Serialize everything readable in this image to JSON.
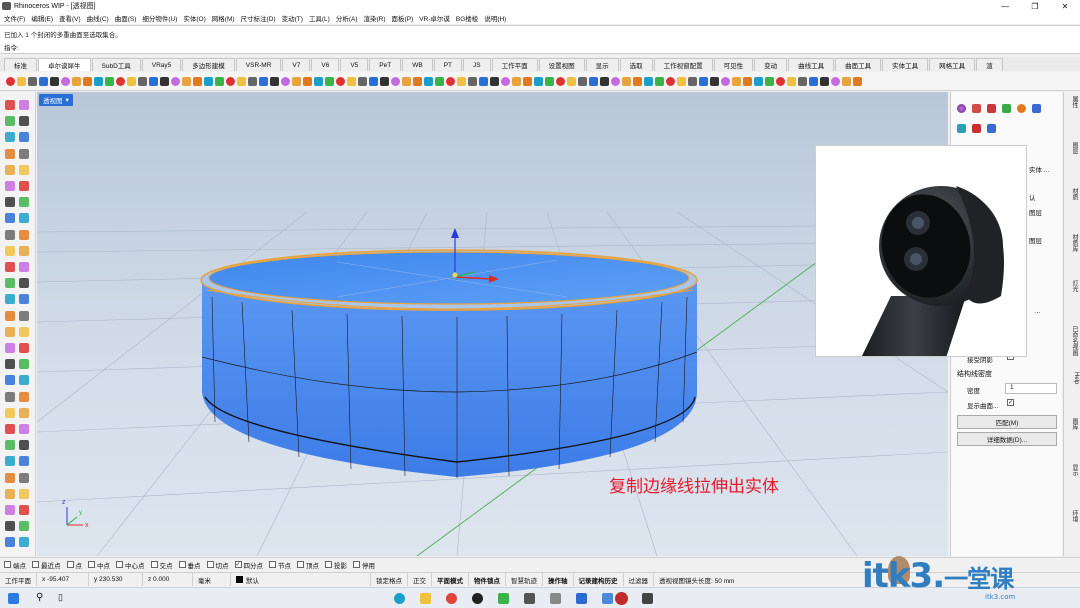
{
  "window": {
    "title": "Rhinoceros WIP - [透视图]",
    "controls": [
      "—",
      "❐",
      "✕"
    ]
  },
  "menu": [
    "文件(F)",
    "编辑(E)",
    "查看(V)",
    "曲线(C)",
    "曲面(S)",
    "细分物件(U)",
    "实体(O)",
    "网格(M)",
    "尺寸标注(D)",
    "变动(T)",
    "工具(L)",
    "分析(A)",
    "渲染(R)",
    "面板(P)",
    "VR-卓尔谟",
    "BG楼梭",
    "说明(H)"
  ],
  "command": {
    "history": "已加入 1 个封闭的多重曲面至选取集合。",
    "prompt": "指令:",
    "input": ""
  },
  "tabs": [
    "标准",
    "卓尔谟犀牛",
    "SubD工具",
    "VRay5",
    "多边形建模",
    "VSR-MR",
    "V7",
    "V6",
    "V5",
    "PeT",
    "WB",
    "PT",
    "JS",
    "工作平面",
    "设置视图",
    "显示",
    "选取",
    "工作视窗配置",
    "可见性",
    "变动",
    "曲线工具",
    "曲面工具",
    "实体工具",
    "网格工具",
    "渲"
  ],
  "active_tab": "卓尔谟犀牛",
  "viewport": {
    "name": "透视图",
    "annotation": "复制边缘线拉伸出实体",
    "axes": {
      "x": "x",
      "y": "y",
      "z": "z"
    }
  },
  "right_panel": {
    "truncated": [
      "实体 ...",
      "认",
      "图层",
      "图层",
      "..."
    ],
    "section_title": "结构线密度",
    "isocurve_label": "接受阴影",
    "density_label": "密度",
    "density_value": "1",
    "show_surface_label": "显示曲面...",
    "match_button": "匹配(M)",
    "details_button": "详细数据(D)..."
  },
  "side_tabs": [
    "属性",
    "图层",
    "材质",
    "材质库",
    "灯光",
    "已命名视图",
    "Help",
    "图库",
    "显示",
    "环境"
  ],
  "osnap": [
    {
      "label": "端点",
      "checked": false
    },
    {
      "label": "最近点",
      "checked": false
    },
    {
      "label": "点",
      "checked": false
    },
    {
      "label": "中点",
      "checked": false
    },
    {
      "label": "中心点",
      "checked": false
    },
    {
      "label": "交点",
      "checked": false
    },
    {
      "label": "垂点",
      "checked": false
    },
    {
      "label": "切点",
      "checked": false
    },
    {
      "label": "四分点",
      "checked": true
    },
    {
      "label": "节点",
      "checked": false
    },
    {
      "label": "顶点",
      "checked": false
    },
    {
      "label": "投影",
      "checked": false
    },
    {
      "label": "停用",
      "checked": false
    }
  ],
  "status": {
    "cplane": "工作平面",
    "x": "x -95.407",
    "y": "y 230.530",
    "z": "z 0.000",
    "unit": "毫米",
    "layer": "默认",
    "toggles": [
      "锁定格点",
      "正交",
      "平面模式",
      "物件锁点",
      "智慧轨迹",
      "操作轴",
      "记录建构历史",
      "过滤器"
    ],
    "bold_toggles": [
      "平面模式",
      "物件锁点",
      "操作轴",
      "记录建构历史"
    ],
    "message": "透视视图镜头长度: 50 mm"
  },
  "watermark": {
    "main": "itk3",
    "dot": ".",
    "cn": "一堂课",
    "sub": "itk3.com"
  },
  "colors": {
    "accent": "#2a6fd6",
    "model_blue": "#4f8df0",
    "edge_orange": "#e8a33c",
    "annotation_red": "#e8192c"
  }
}
